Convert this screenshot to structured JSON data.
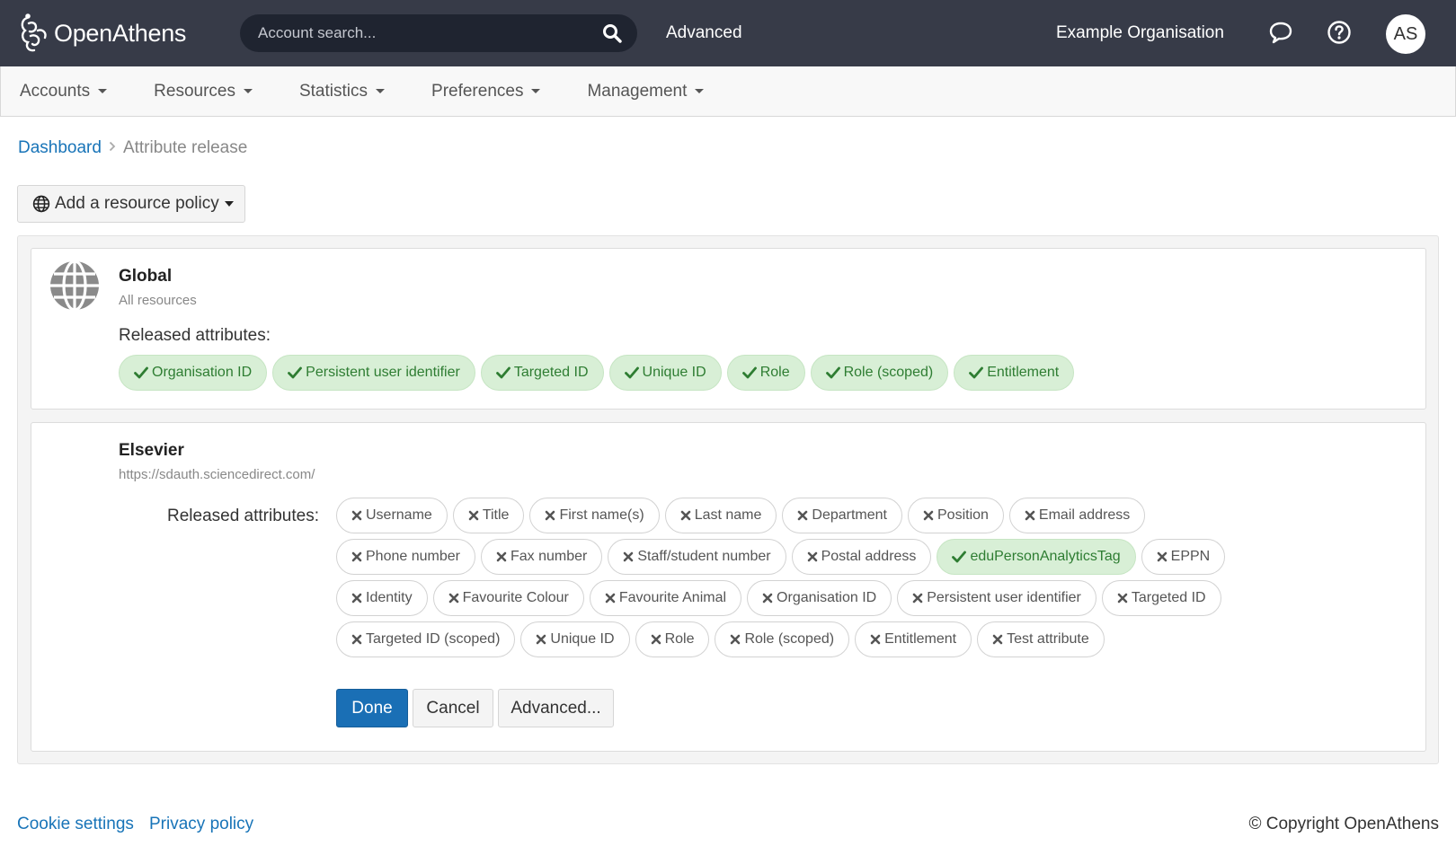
{
  "header": {
    "logo_text": "OpenAthens",
    "search_placeholder": "Account search...",
    "advanced_label": "Advanced",
    "organisation": "Example Organisation",
    "avatar_initials": "AS"
  },
  "nav": {
    "items": [
      {
        "label": "Accounts"
      },
      {
        "label": "Resources"
      },
      {
        "label": "Statistics"
      },
      {
        "label": "Preferences"
      },
      {
        "label": "Management"
      }
    ]
  },
  "breadcrumb": {
    "home": "Dashboard",
    "current": "Attribute release"
  },
  "add_policy_label": "Add a resource policy",
  "global_policy": {
    "title": "Global",
    "subtitle": "All resources",
    "released_label": "Released attributes:",
    "attributes": [
      {
        "label": "Organisation ID",
        "released": true
      },
      {
        "label": "Persistent user identifier",
        "released": true
      },
      {
        "label": "Targeted ID",
        "released": true
      },
      {
        "label": "Unique ID",
        "released": true
      },
      {
        "label": "Role",
        "released": true
      },
      {
        "label": "Role (scoped)",
        "released": true
      },
      {
        "label": "Entitlement",
        "released": true
      }
    ]
  },
  "resource_policy": {
    "title": "Elsevier",
    "subtitle": "https://sdauth.sciencedirect.com/",
    "released_label": "Released attributes:",
    "attributes": [
      {
        "label": "Username",
        "released": false
      },
      {
        "label": "Title",
        "released": false
      },
      {
        "label": "First name(s)",
        "released": false
      },
      {
        "label": "Last name",
        "released": false
      },
      {
        "label": "Department",
        "released": false
      },
      {
        "label": "Position",
        "released": false
      },
      {
        "label": "Email address",
        "released": false
      },
      {
        "label": "Phone number",
        "released": false
      },
      {
        "label": "Fax number",
        "released": false
      },
      {
        "label": "Staff/student number",
        "released": false
      },
      {
        "label": "Postal address",
        "released": false
      },
      {
        "label": "eduPersonAnalyticsTag",
        "released": true
      },
      {
        "label": "EPPN",
        "released": false
      },
      {
        "label": "Identity",
        "released": false
      },
      {
        "label": "Favourite Colour",
        "released": false
      },
      {
        "label": "Favourite Animal",
        "released": false
      },
      {
        "label": "Organisation ID",
        "released": false
      },
      {
        "label": "Persistent user identifier",
        "released": false
      },
      {
        "label": "Targeted ID",
        "released": false
      },
      {
        "label": "Targeted ID (scoped)",
        "released": false
      },
      {
        "label": "Unique ID",
        "released": false
      },
      {
        "label": "Role",
        "released": false
      },
      {
        "label": "Role (scoped)",
        "released": false
      },
      {
        "label": "Entitlement",
        "released": false
      },
      {
        "label": "Test attribute",
        "released": false
      }
    ],
    "buttons": {
      "done": "Done",
      "cancel": "Cancel",
      "advanced": "Advanced..."
    }
  },
  "footer": {
    "cookie_settings": "Cookie settings",
    "privacy_policy": "Privacy policy",
    "copyright": "© Copyright OpenAthens"
  },
  "colors": {
    "header_bg": "#373b48",
    "search_bg": "#1f2430",
    "link": "#1874b8",
    "primary_button": "#1a6fb5",
    "released_chip_bg": "#d8efd6",
    "released_chip_text": "#2e7d32"
  },
  "icons": {
    "search": "search-icon",
    "chat": "chat-icon",
    "help": "help-icon",
    "globe": "globe-icon",
    "released": "check-icon",
    "not_released": "cross-icon"
  }
}
